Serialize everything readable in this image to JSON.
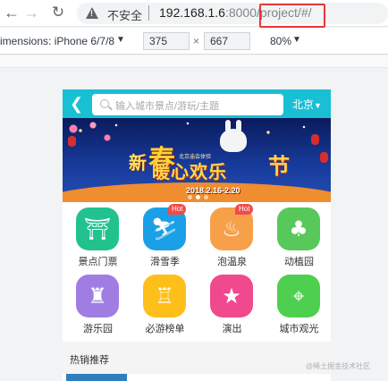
{
  "browser": {
    "insecure_label": "不安全",
    "url_host": "192.168.1.6",
    "url_port": ":8000",
    "url_path": "/project/#/"
  },
  "devtools": {
    "device_label": "imensions: iPhone 6/7/8",
    "width": "375",
    "times": "×",
    "height": "667",
    "zoom": "80%"
  },
  "app": {
    "search_placeholder": "输入城市景点/游玩/主题",
    "city": "北京",
    "banner": {
      "char_xin": "新",
      "char_chun": "春",
      "subtitle": "北京庙会体验",
      "main": "暖心欢乐",
      "char_jie": "节",
      "date": "2018.2.16-2.20"
    },
    "grid": [
      {
        "label": "景点门票",
        "icon": "temple-icon",
        "color": "#21c28e",
        "glyph": "⛩",
        "hot": ""
      },
      {
        "label": "滑雪季",
        "icon": "skier-icon",
        "color": "#1ba0e8",
        "glyph": "⛷",
        "hot": "Hot"
      },
      {
        "label": "泡温泉",
        "icon": "hot-spring-icon",
        "color": "#f7a04a",
        "glyph": "♨",
        "hot": "Hot"
      },
      {
        "label": "动植园",
        "icon": "tree-icon",
        "color": "#58c85a",
        "glyph": "♣",
        "hot": ""
      },
      {
        "label": "游乐园",
        "icon": "carousel-icon",
        "color": "#a07de2",
        "glyph": "♜",
        "hot": ""
      },
      {
        "label": "必游榜单",
        "icon": "castle-icon",
        "color": "#ffbf1a",
        "glyph": "♖",
        "hot": ""
      },
      {
        "label": "演出",
        "icon": "stage-icon",
        "color": "#f0498e",
        "glyph": "★",
        "hot": ""
      },
      {
        "label": "城市观光",
        "icon": "map-pin-icon",
        "color": "#4fcf4f",
        "glyph": "⌖",
        "hot": ""
      }
    ],
    "section_title": "热销推荐"
  },
  "watermark": "@稀土掘金技术社区"
}
